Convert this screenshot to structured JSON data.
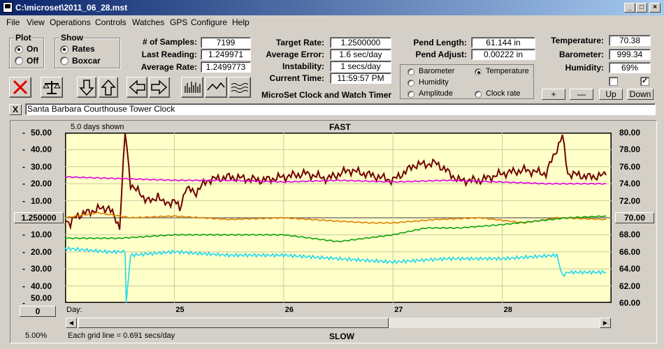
{
  "window": {
    "title": "C:\\microset\\2011_06_28.mst"
  },
  "menu": [
    "File",
    "View",
    "Operations",
    "Controls",
    "Watches",
    "GPS",
    "Configure",
    "Help"
  ],
  "plot_group": {
    "title": "Plot",
    "on_label": "On",
    "off_label": "Off",
    "selected": "On"
  },
  "show_group": {
    "title": "Show",
    "rates_label": "Rates",
    "boxcar_label": "Boxcar",
    "selected": "Rates"
  },
  "stats": {
    "samples_label": "# of Samples:",
    "samples_value": "7199",
    "last_reading_label": "Last Reading:",
    "last_reading_value": "1.249971",
    "average_rate_label": "Average Rate:",
    "average_rate_value": "1.2499773"
  },
  "timing": {
    "target_rate_label": "Target Rate:",
    "target_rate_value": "1.2500000",
    "average_error_label": "Average Error:",
    "average_error_value": "1.6 sec/day",
    "instability_label": "Instability:",
    "instability_value": "1 secs/day",
    "current_time_label": "Current Time:",
    "current_time_value": "11:59:57 PM",
    "app_caption": "MicroSet Clock and Watch Timer"
  },
  "pendulum": {
    "length_label": "Pend Length:",
    "length_value": "61.144 in",
    "adjust_label": "Pend Adjust:",
    "adjust_value": "0.00222 in"
  },
  "environment": {
    "temperature_label": "Temperature:",
    "temperature_value": "70.38",
    "barometer_label": "Barometer:",
    "barometer_value": "999.34",
    "humidity_label": "Humidity:",
    "humidity_value": "69%"
  },
  "trace_options": {
    "barometer": "Barometer",
    "temperature": "Temperature",
    "humidity": "Humidity",
    "amplitude": "Amplitude",
    "clock_rate": "Clock rate",
    "selected": "Temperature",
    "colors": {
      "barometer": "#e08000",
      "temperature": "#00a000",
      "humidity": "#c000c0",
      "amplitude": "#00c0e0",
      "clock_rate": "#000000"
    }
  },
  "scale_buttons": {
    "plus": "+",
    "minus": "—",
    "up": "Up",
    "down": "Down"
  },
  "description": {
    "text": "Santa Barbara Courthouse Tower Clock",
    "close": "X"
  },
  "chart_data": {
    "type": "line",
    "title": "FAST",
    "bottom_caption": "SLOW",
    "days_shown": "5.0 days shown",
    "grid_note": "Each grid line = 0.691 secs/day",
    "zoom": "5.00%",
    "left_axis_labels": [
      "50.00",
      "40.00",
      "30.00",
      "20.00",
      "10.00",
      "10.00",
      "20.00",
      "30.00",
      "40.00",
      "50.00"
    ],
    "left_axis_dashes": [
      "-",
      "-",
      "-",
      "-",
      "-",
      "-",
      "-",
      "-",
      "-",
      "-"
    ],
    "center_rate": "1.250000",
    "bottom_left_value": "0",
    "right_axis_labels": [
      "80.00",
      "78.00",
      "76.00",
      "74.00",
      "72.00",
      "70.00",
      "68.00",
      "66.00",
      "64.00",
      "62.00",
      "60.00"
    ],
    "right_center": "70.00",
    "x_labels": [
      "Day:",
      "25",
      "26",
      "27",
      "28"
    ],
    "x_start_day": 24,
    "x_end_day": 29,
    "series": [
      {
        "name": "clock_rate",
        "color": "#700000",
        "axis": "left",
        "points": [
          [
            24.0,
            0
          ],
          [
            24.05,
            -4
          ],
          [
            24.1,
            1
          ],
          [
            24.2,
            3
          ],
          [
            24.3,
            5
          ],
          [
            24.4,
            6
          ],
          [
            24.5,
            -5
          ],
          [
            24.55,
            50
          ],
          [
            24.6,
            20
          ],
          [
            24.7,
            13
          ],
          [
            24.8,
            9
          ],
          [
            24.85,
            14
          ],
          [
            24.9,
            8
          ],
          [
            25.0,
            10
          ],
          [
            25.05,
            5
          ],
          [
            25.1,
            17
          ],
          [
            25.2,
            15
          ],
          [
            25.3,
            22
          ],
          [
            25.5,
            24
          ],
          [
            25.8,
            22
          ],
          [
            26.0,
            24
          ],
          [
            26.2,
            26
          ],
          [
            26.4,
            23
          ],
          [
            26.6,
            28
          ],
          [
            26.8,
            25
          ],
          [
            27.0,
            22
          ],
          [
            27.2,
            31
          ],
          [
            27.4,
            32
          ],
          [
            27.6,
            22
          ],
          [
            27.8,
            22
          ],
          [
            28.0,
            26
          ],
          [
            28.2,
            28
          ],
          [
            28.4,
            26
          ],
          [
            28.55,
            48
          ],
          [
            28.6,
            26
          ],
          [
            28.8,
            24
          ],
          [
            28.95,
            25
          ]
        ]
      },
      {
        "name": "humidity",
        "color": "#e000e0",
        "axis": "left",
        "points": [
          [
            24.0,
            24
          ],
          [
            24.5,
            23
          ],
          [
            25.0,
            22
          ],
          [
            25.5,
            22
          ],
          [
            26.0,
            21
          ],
          [
            26.5,
            22
          ],
          [
            27.0,
            21
          ],
          [
            27.5,
            22
          ],
          [
            28.0,
            21
          ],
          [
            28.4,
            20
          ],
          [
            28.95,
            20
          ]
        ]
      },
      {
        "name": "barometer",
        "color": "#e08000",
        "axis": "left",
        "points": [
          [
            24.0,
            0
          ],
          [
            24.3,
            3
          ],
          [
            24.6,
            0
          ],
          [
            25.0,
            1
          ],
          [
            25.5,
            -1
          ],
          [
            26.0,
            0
          ],
          [
            26.5,
            -2
          ],
          [
            26.8,
            -3
          ],
          [
            27.0,
            -3
          ],
          [
            27.4,
            -1
          ],
          [
            27.8,
            0
          ],
          [
            28.2,
            -3
          ],
          [
            28.5,
            0
          ],
          [
            28.95,
            -1
          ]
        ]
      },
      {
        "name": "temperature",
        "color": "#10a010",
        "axis": "left",
        "points": [
          [
            24.0,
            -12
          ],
          [
            24.5,
            -12
          ],
          [
            25.0,
            -10
          ],
          [
            25.3,
            -10
          ],
          [
            25.6,
            -10
          ],
          [
            26.0,
            -10
          ],
          [
            26.5,
            -14
          ],
          [
            27.0,
            -10
          ],
          [
            27.3,
            -6
          ],
          [
            27.6,
            -6
          ],
          [
            28.0,
            -4
          ],
          [
            28.3,
            -2
          ],
          [
            28.6,
            0
          ],
          [
            28.95,
            1
          ]
        ]
      },
      {
        "name": "amplitude",
        "color": "#20d8f0",
        "axis": "left",
        "points": [
          [
            24.0,
            -18
          ],
          [
            24.4,
            -20
          ],
          [
            24.55,
            -20
          ],
          [
            24.56,
            -50
          ],
          [
            24.6,
            -22
          ],
          [
            25.0,
            -20
          ],
          [
            25.5,
            -22
          ],
          [
            26.0,
            -22
          ],
          [
            26.5,
            -24
          ],
          [
            27.0,
            -26
          ],
          [
            27.5,
            -24
          ],
          [
            28.0,
            -24
          ],
          [
            28.5,
            -22
          ],
          [
            28.55,
            -34
          ],
          [
            28.6,
            -32
          ],
          [
            28.95,
            -32
          ]
        ]
      }
    ],
    "ylim": [
      -50,
      50
    ]
  }
}
